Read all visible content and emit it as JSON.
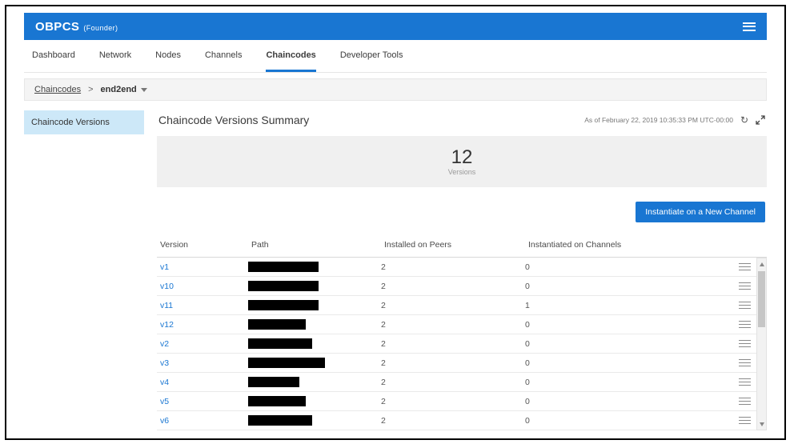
{
  "colors": {
    "accent": "#1976d2",
    "sidebar_selected": "#cde8f8",
    "summary_bg": "#f0f0f0"
  },
  "header": {
    "title": "OBPCS",
    "subtitle": "(Founder)"
  },
  "tabs": [
    {
      "label": "Dashboard",
      "active": false
    },
    {
      "label": "Network",
      "active": false
    },
    {
      "label": "Nodes",
      "active": false
    },
    {
      "label": "Channels",
      "active": false
    },
    {
      "label": "Chaincodes",
      "active": true
    },
    {
      "label": "Developer Tools",
      "active": false
    }
  ],
  "breadcrumb": {
    "root": "Chaincodes",
    "separator": ">",
    "current": "end2end"
  },
  "sidebar": {
    "items": [
      {
        "label": "Chaincode Versions",
        "selected": true
      }
    ]
  },
  "summary": {
    "title": "Chaincode Versions Summary",
    "as_of": "As of February 22, 2019 10:35:33 PM UTC-00:00",
    "count": "12",
    "count_label": "Versions"
  },
  "icons": {
    "refresh": "↻"
  },
  "actions": {
    "instantiate_label": "Instantiate on a New Channel"
  },
  "table": {
    "columns": [
      "Version",
      "Path",
      "Installed on Peers",
      "Instantiated on Channels"
    ],
    "rows": [
      {
        "version": "v1",
        "path_redacted": true,
        "path_w": 88,
        "installed": "2",
        "instantiated": "0"
      },
      {
        "version": "v10",
        "path_redacted": true,
        "path_w": 88,
        "installed": "2",
        "instantiated": "0"
      },
      {
        "version": "v11",
        "path_redacted": true,
        "path_w": 88,
        "installed": "2",
        "instantiated": "1"
      },
      {
        "version": "v12",
        "path_redacted": true,
        "path_w": 72,
        "installed": "2",
        "instantiated": "0"
      },
      {
        "version": "v2",
        "path_redacted": true,
        "path_w": 80,
        "installed": "2",
        "instantiated": "0"
      },
      {
        "version": "v3",
        "path_redacted": true,
        "path_w": 96,
        "installed": "2",
        "instantiated": "0"
      },
      {
        "version": "v4",
        "path_redacted": true,
        "path_w": 64,
        "installed": "2",
        "instantiated": "0"
      },
      {
        "version": "v5",
        "path_redacted": true,
        "path_w": 72,
        "installed": "2",
        "instantiated": "0"
      },
      {
        "version": "v6",
        "path_redacted": true,
        "path_w": 80,
        "installed": "2",
        "instantiated": "0"
      }
    ]
  }
}
